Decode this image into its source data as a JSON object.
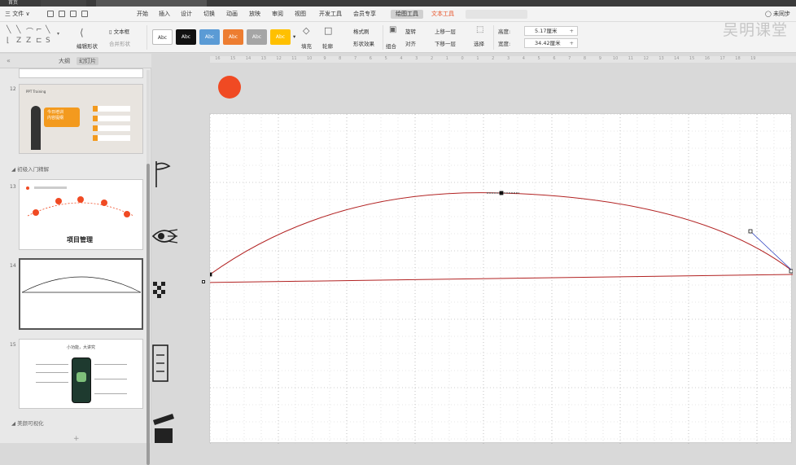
{
  "titlebar": {
    "tabs": [
      "首页",
      "",
      "",
      "",
      ""
    ]
  },
  "ribbon_tabs": {
    "menu": "三 文件 ∨",
    "items": [
      "开始",
      "插入",
      "设计",
      "切换",
      "动画",
      "放映",
      "审阅",
      "视图",
      "开发工具",
      "会员专享",
      "绘图工具",
      "文本工具"
    ],
    "active": "绘图工具",
    "context": "文本工具",
    "search_placeholder": "",
    "right_label": "◯ 未同步"
  },
  "ribbon": {
    "edit_shape_label": "编辑形状",
    "textbox_label": "文本框",
    "text_arrange_label": "▯ 文本框",
    "merge_label": "合并形状",
    "style_labels": [
      "Abc",
      "Abc",
      "Abc",
      "Abc",
      "Abc",
      "Abc"
    ],
    "style_colors": [
      "#ffffff",
      "#111111",
      "#5b9bd5",
      "#ed7d31",
      "#a5a5a5",
      "#ffc000"
    ],
    "fill_label": "填充",
    "outline_label": "轮廓",
    "format_brush": "格式刷",
    "shape_effect": "形状效果",
    "rotate_label": "旋转",
    "up_one": "上移一层",
    "down_one": "下移一层",
    "align_label": "对齐",
    "group_label": "组合",
    "select_label": "选择",
    "height_label": "高度:",
    "height_value": "5.17厘米",
    "width_label": "宽度:",
    "width_value": "34.42厘米"
  },
  "watermark": "吴明课堂",
  "panel": {
    "tabs": [
      "大纲",
      "幻灯片"
    ],
    "active_tab": "幻灯片",
    "slides": [
      {
        "num": "12",
        "title": "今日培训\n内容提纲",
        "tag": "PPT Training"
      },
      {
        "num": "13",
        "title": "项目管理"
      },
      {
        "num": "14"
      },
      {
        "num": "15",
        "title": "小功能，大讲究"
      }
    ],
    "sections": [
      "初级入门精解",
      "美颜可视化"
    ]
  },
  "ruler_numbers": [
    "16",
    "15",
    "14",
    "13",
    "12",
    "11",
    "10",
    "9",
    "8",
    "7",
    "6",
    "5",
    "4",
    "3",
    "2",
    "1",
    "0",
    "1",
    "2",
    "3",
    "4",
    "5",
    "6",
    "7",
    "8",
    "9",
    "10",
    "11",
    "12",
    "13",
    "14",
    "15",
    "16",
    "17",
    "18",
    "19"
  ],
  "colors": {
    "curve": "#b22222",
    "record_dot": "#f04a23",
    "accent_orange": "#e8542a"
  },
  "slide_icons": [
    "flag-icon",
    "eye-icon",
    "checkered-flag-icon",
    "document-icon",
    "clapper-icon"
  ]
}
